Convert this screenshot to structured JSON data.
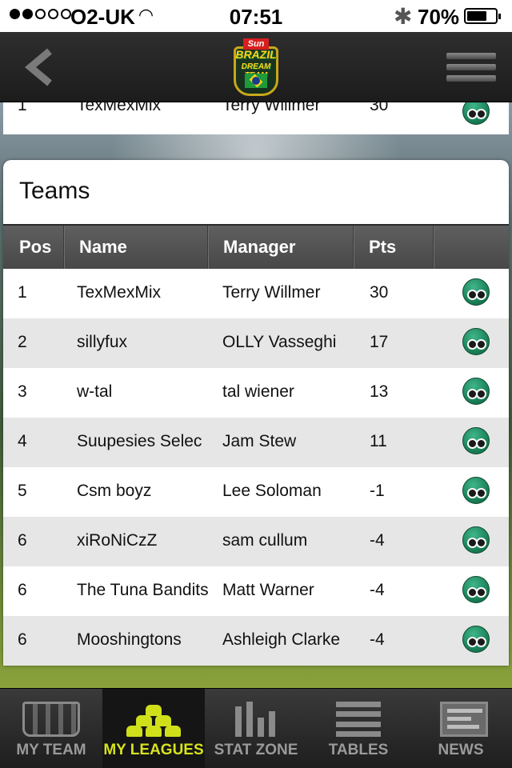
{
  "status_bar": {
    "carrier": "O2-UK",
    "time": "07:51",
    "battery_pct": "70%",
    "signal_bars_filled": 2,
    "signal_bars_total": 5
  },
  "header": {
    "logo": {
      "line1": "Sun",
      "line2": "BRAZIL",
      "line3": "DREAM TEAM"
    }
  },
  "peek_row": {
    "pos": "1",
    "name": "TexMexMix",
    "manager": "Terry Willmer",
    "pts": "30"
  },
  "teams": {
    "title": "Teams",
    "columns": {
      "pos": "Pos",
      "name": "Name",
      "manager": "Manager",
      "pts": "Pts"
    },
    "rows": [
      {
        "pos": "1",
        "name": "TexMexMix",
        "manager": "Terry Willmer",
        "pts": "30"
      },
      {
        "pos": "2",
        "name": "sillyfux",
        "manager": "OLLY Vasseghi",
        "pts": "17"
      },
      {
        "pos": "3",
        "name": "w-tal",
        "manager": "tal wiener",
        "pts": "13"
      },
      {
        "pos": "4",
        "name": "Suupesies Selec",
        "manager": "Jam Stew",
        "pts": "11"
      },
      {
        "pos": "5",
        "name": "Csm boyz",
        "manager": "Lee Soloman",
        "pts": "-1"
      },
      {
        "pos": "6",
        "name": "xiRoNiCzZ",
        "manager": "sam cullum",
        "pts": "-4"
      },
      {
        "pos": "6",
        "name": "The Tuna Bandits",
        "manager": "Matt Warner",
        "pts": "-4"
      },
      {
        "pos": "6",
        "name": "Mooshingtons",
        "manager": "Ashleigh Clarke",
        "pts": "-4"
      }
    ]
  },
  "tab_bar": {
    "active": "my-leagues",
    "tabs": [
      {
        "id": "my-team",
        "label": "MY TEAM"
      },
      {
        "id": "my-leagues",
        "label": "MY LEAGUES"
      },
      {
        "id": "stat-zone",
        "label": "STAT ZONE"
      },
      {
        "id": "tables",
        "label": "TABLES"
      },
      {
        "id": "news",
        "label": "NEWS"
      }
    ]
  },
  "colors": {
    "accent_active_tab": "#d6e31e",
    "view_button": "#177a52",
    "table_header": "#555555"
  }
}
